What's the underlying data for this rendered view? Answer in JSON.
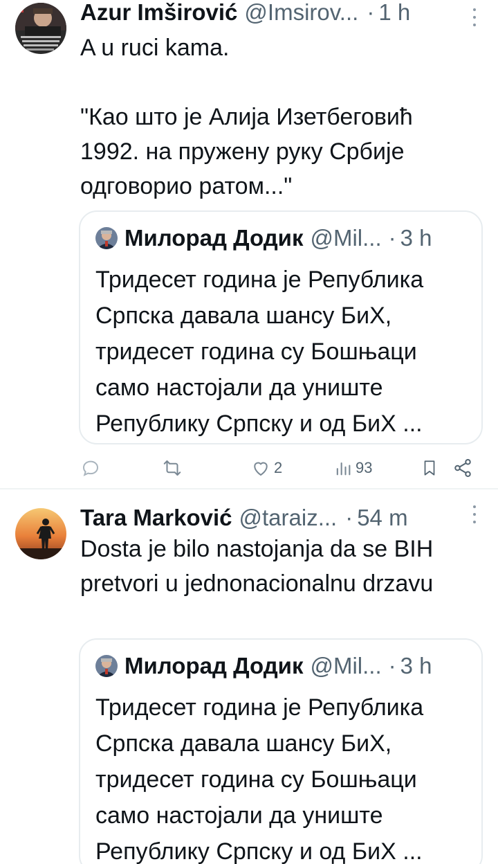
{
  "tweets": [
    {
      "author_name": "Azur Imširović",
      "handle": "@Imsirov...",
      "separator": "·",
      "time": "1 h",
      "text": "A u ruci kama.\n\n\"Као што је Алија Изетбеговић 1992. на пружену руку Србије одговорио ратом...\"",
      "quote": {
        "author_name": "Милорад Додик",
        "handle": "@Mil...",
        "separator": "·",
        "time": "3 h",
        "text": "Тридесет година је Република Српска давала шансу БиХ, тридесет година су Бошњаци само настојали да униште Републику Српску и од БиХ ..."
      },
      "actions": {
        "reply_icon": "reply-icon",
        "retweet_icon": "retweet-icon",
        "like_icon": "heart-icon",
        "like_count": "2",
        "views_icon": "views-icon",
        "views_count": "93",
        "bookmark_icon": "bookmark-icon",
        "share_icon": "share-icon"
      }
    },
    {
      "author_name": "Tara Marković",
      "handle": "@taraiz...",
      "separator": "·",
      "time": "54 m",
      "text": "Dosta je bilo nastojanja da se BIH pretvori u jednonacionalnu drzavu",
      "quote": {
        "author_name": "Милорад Додик",
        "handle": "@Mil...",
        "separator": "·",
        "time": "3 h",
        "text": "Тридесет година је Република Српска давала шансу БиХ, тридесет година су Бошњаци само настојали да униште Републику Српску и од БиХ ..."
      }
    }
  ],
  "colors": {
    "text_primary": "#0f1419",
    "text_secondary": "#536471",
    "border": "#e7ecef",
    "background": "#ffffff"
  }
}
